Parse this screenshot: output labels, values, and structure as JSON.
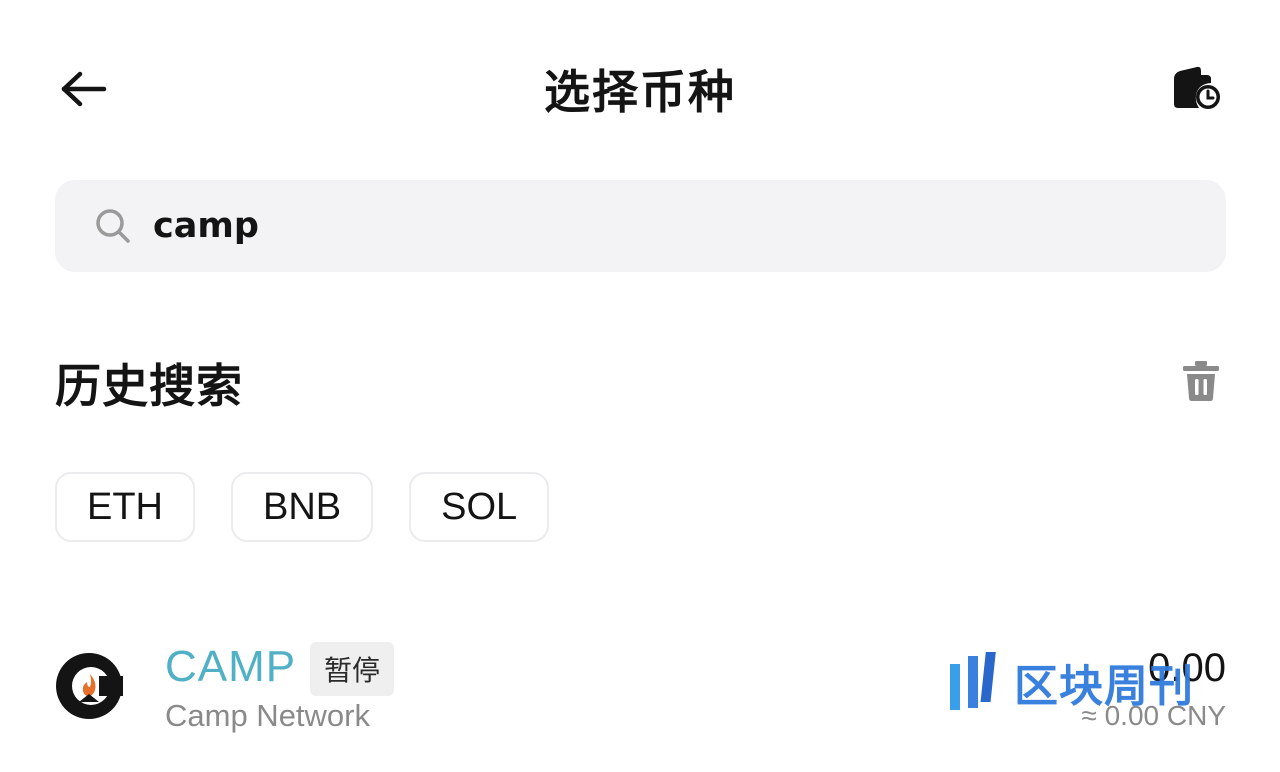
{
  "header": {
    "title": "选择币种",
    "back_icon": "arrow-left-icon",
    "history_icon": "wallet-clock-icon"
  },
  "search": {
    "value": "camp",
    "placeholder": "",
    "icon": "search-icon"
  },
  "history": {
    "title": "历史搜索",
    "clear_icon": "trash-icon",
    "chips": [
      {
        "label": "ETH"
      },
      {
        "label": "BNB"
      },
      {
        "label": "SOL"
      }
    ]
  },
  "results": [
    {
      "symbol": "CAMP",
      "badge": "暂停",
      "name": "Camp Network",
      "balance": "0.00",
      "fiat": "≈ 0.00 CNY",
      "logo_icon": "camp-network-logo",
      "symbol_color": "#4fb0c6"
    }
  ],
  "watermark": {
    "text": "区块周刊"
  },
  "colors": {
    "accent": "#4fb0c6",
    "search_bg": "#f3f3f5",
    "muted_text": "#8a8a8a",
    "watermark": "#2f7bdc"
  }
}
